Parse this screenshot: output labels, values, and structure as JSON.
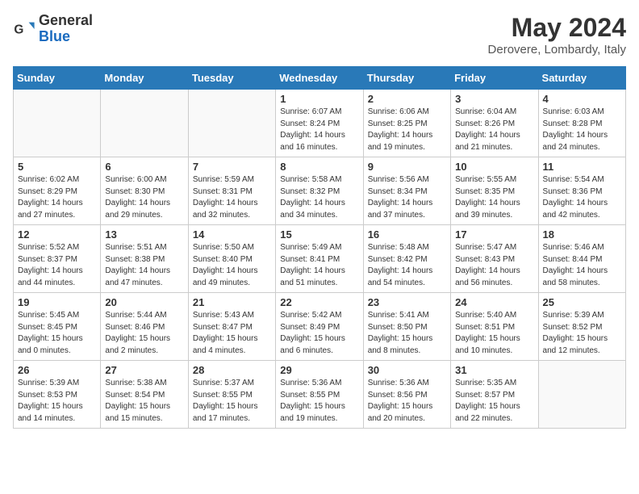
{
  "header": {
    "logo_general": "General",
    "logo_blue": "Blue",
    "month_title": "May 2024",
    "location": "Derovere, Lombardy, Italy"
  },
  "days_of_week": [
    "Sunday",
    "Monday",
    "Tuesday",
    "Wednesday",
    "Thursday",
    "Friday",
    "Saturday"
  ],
  "weeks": [
    [
      {
        "day": "",
        "info": ""
      },
      {
        "day": "",
        "info": ""
      },
      {
        "day": "",
        "info": ""
      },
      {
        "day": "1",
        "info": "Sunrise: 6:07 AM\nSunset: 8:24 PM\nDaylight: 14 hours\nand 16 minutes."
      },
      {
        "day": "2",
        "info": "Sunrise: 6:06 AM\nSunset: 8:25 PM\nDaylight: 14 hours\nand 19 minutes."
      },
      {
        "day": "3",
        "info": "Sunrise: 6:04 AM\nSunset: 8:26 PM\nDaylight: 14 hours\nand 21 minutes."
      },
      {
        "day": "4",
        "info": "Sunrise: 6:03 AM\nSunset: 8:28 PM\nDaylight: 14 hours\nand 24 minutes."
      }
    ],
    [
      {
        "day": "5",
        "info": "Sunrise: 6:02 AM\nSunset: 8:29 PM\nDaylight: 14 hours\nand 27 minutes."
      },
      {
        "day": "6",
        "info": "Sunrise: 6:00 AM\nSunset: 8:30 PM\nDaylight: 14 hours\nand 29 minutes."
      },
      {
        "day": "7",
        "info": "Sunrise: 5:59 AM\nSunset: 8:31 PM\nDaylight: 14 hours\nand 32 minutes."
      },
      {
        "day": "8",
        "info": "Sunrise: 5:58 AM\nSunset: 8:32 PM\nDaylight: 14 hours\nand 34 minutes."
      },
      {
        "day": "9",
        "info": "Sunrise: 5:56 AM\nSunset: 8:34 PM\nDaylight: 14 hours\nand 37 minutes."
      },
      {
        "day": "10",
        "info": "Sunrise: 5:55 AM\nSunset: 8:35 PM\nDaylight: 14 hours\nand 39 minutes."
      },
      {
        "day": "11",
        "info": "Sunrise: 5:54 AM\nSunset: 8:36 PM\nDaylight: 14 hours\nand 42 minutes."
      }
    ],
    [
      {
        "day": "12",
        "info": "Sunrise: 5:52 AM\nSunset: 8:37 PM\nDaylight: 14 hours\nand 44 minutes."
      },
      {
        "day": "13",
        "info": "Sunrise: 5:51 AM\nSunset: 8:38 PM\nDaylight: 14 hours\nand 47 minutes."
      },
      {
        "day": "14",
        "info": "Sunrise: 5:50 AM\nSunset: 8:40 PM\nDaylight: 14 hours\nand 49 minutes."
      },
      {
        "day": "15",
        "info": "Sunrise: 5:49 AM\nSunset: 8:41 PM\nDaylight: 14 hours\nand 51 minutes."
      },
      {
        "day": "16",
        "info": "Sunrise: 5:48 AM\nSunset: 8:42 PM\nDaylight: 14 hours\nand 54 minutes."
      },
      {
        "day": "17",
        "info": "Sunrise: 5:47 AM\nSunset: 8:43 PM\nDaylight: 14 hours\nand 56 minutes."
      },
      {
        "day": "18",
        "info": "Sunrise: 5:46 AM\nSunset: 8:44 PM\nDaylight: 14 hours\nand 58 minutes."
      }
    ],
    [
      {
        "day": "19",
        "info": "Sunrise: 5:45 AM\nSunset: 8:45 PM\nDaylight: 15 hours\nand 0 minutes."
      },
      {
        "day": "20",
        "info": "Sunrise: 5:44 AM\nSunset: 8:46 PM\nDaylight: 15 hours\nand 2 minutes."
      },
      {
        "day": "21",
        "info": "Sunrise: 5:43 AM\nSunset: 8:47 PM\nDaylight: 15 hours\nand 4 minutes."
      },
      {
        "day": "22",
        "info": "Sunrise: 5:42 AM\nSunset: 8:49 PM\nDaylight: 15 hours\nand 6 minutes."
      },
      {
        "day": "23",
        "info": "Sunrise: 5:41 AM\nSunset: 8:50 PM\nDaylight: 15 hours\nand 8 minutes."
      },
      {
        "day": "24",
        "info": "Sunrise: 5:40 AM\nSunset: 8:51 PM\nDaylight: 15 hours\nand 10 minutes."
      },
      {
        "day": "25",
        "info": "Sunrise: 5:39 AM\nSunset: 8:52 PM\nDaylight: 15 hours\nand 12 minutes."
      }
    ],
    [
      {
        "day": "26",
        "info": "Sunrise: 5:39 AM\nSunset: 8:53 PM\nDaylight: 15 hours\nand 14 minutes."
      },
      {
        "day": "27",
        "info": "Sunrise: 5:38 AM\nSunset: 8:54 PM\nDaylight: 15 hours\nand 15 minutes."
      },
      {
        "day": "28",
        "info": "Sunrise: 5:37 AM\nSunset: 8:55 PM\nDaylight: 15 hours\nand 17 minutes."
      },
      {
        "day": "29",
        "info": "Sunrise: 5:36 AM\nSunset: 8:55 PM\nDaylight: 15 hours\nand 19 minutes."
      },
      {
        "day": "30",
        "info": "Sunrise: 5:36 AM\nSunset: 8:56 PM\nDaylight: 15 hours\nand 20 minutes."
      },
      {
        "day": "31",
        "info": "Sunrise: 5:35 AM\nSunset: 8:57 PM\nDaylight: 15 hours\nand 22 minutes."
      },
      {
        "day": "",
        "info": ""
      }
    ]
  ]
}
